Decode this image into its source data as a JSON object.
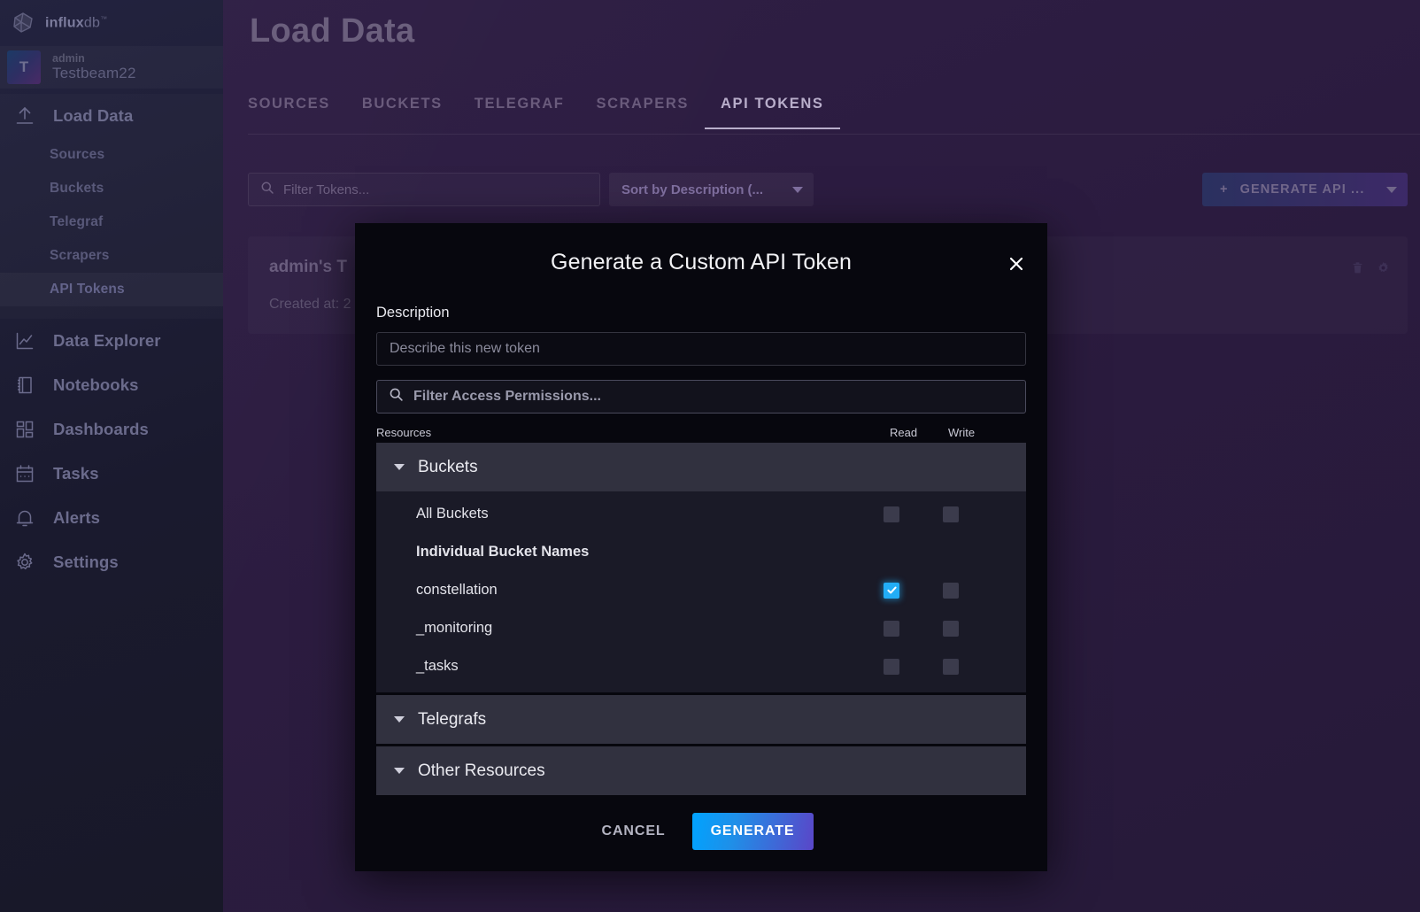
{
  "sidebar": {
    "logo_text_bold": "influx",
    "logo_text_rest": "db",
    "logo_tm": "™",
    "org": {
      "avatar_letter": "T",
      "user": "admin",
      "name": "Testbeam22"
    },
    "primary": {
      "label": "Load Data",
      "icon": "upload-icon"
    },
    "sub_items": [
      {
        "label": "Sources"
      },
      {
        "label": "Buckets"
      },
      {
        "label": "Telegraf"
      },
      {
        "label": "Scrapers"
      },
      {
        "label": "API Tokens"
      }
    ],
    "active_sub": "API Tokens",
    "items": [
      {
        "label": "Data Explorer",
        "icon": "line-chart-icon"
      },
      {
        "label": "Notebooks",
        "icon": "notebook-icon"
      },
      {
        "label": "Dashboards",
        "icon": "dashboard-grid-icon"
      },
      {
        "label": "Tasks",
        "icon": "calendar-icon"
      },
      {
        "label": "Alerts",
        "icon": "bell-icon"
      },
      {
        "label": "Settings",
        "icon": "gear-icon"
      }
    ]
  },
  "page": {
    "title": "Load Data",
    "tabs": [
      {
        "label": "SOURCES",
        "active": false
      },
      {
        "label": "BUCKETS",
        "active": false
      },
      {
        "label": "TELEGRAF",
        "active": false
      },
      {
        "label": "SCRAPERS",
        "active": false
      },
      {
        "label": "API TOKENS",
        "active": true
      }
    ],
    "filter_placeholder": "Filter Tokens...",
    "sort_label": "Sort by Description (...",
    "generate_button": "GENERATE API ...",
    "generate_button_plus": "+",
    "token_card": {
      "title": "admin's T",
      "subtitle": "Created at: 2",
      "delete_icon": "trash-icon",
      "settings_icon": "gear-icon"
    }
  },
  "modal": {
    "title": "Generate a Custom API Token",
    "close_icon": "close-icon",
    "description_label": "Description",
    "description_value": "",
    "description_placeholder": "Describe this new token",
    "permissions_search_placeholder": "Filter Access Permissions...",
    "permissions_search_icon": "search-icon",
    "columns": {
      "resources": "Resources",
      "read": "Read",
      "write": "Write"
    },
    "sections": [
      {
        "label": "Buckets",
        "expanded": true,
        "rows": [
          {
            "label": "All Buckets",
            "type": "item",
            "read": false,
            "write": false
          },
          {
            "label": "Individual Bucket Names",
            "type": "header"
          },
          {
            "label": "constellation",
            "type": "item",
            "read": true,
            "write": false
          },
          {
            "label": "_monitoring",
            "type": "item",
            "read": false,
            "write": false
          },
          {
            "label": "_tasks",
            "type": "item",
            "read": false,
            "write": false
          }
        ]
      },
      {
        "label": "Telegrafs",
        "expanded": false,
        "rows": []
      },
      {
        "label": "Other Resources",
        "expanded": false,
        "rows": []
      }
    ],
    "cancel_label": "CANCEL",
    "generate_label": "GENERATE"
  },
  "colors": {
    "accent_blue": "#22adf6",
    "modal_bg": "#07070e",
    "section_header_bg": "#31313f",
    "main_bg": "#2b1b3f"
  }
}
